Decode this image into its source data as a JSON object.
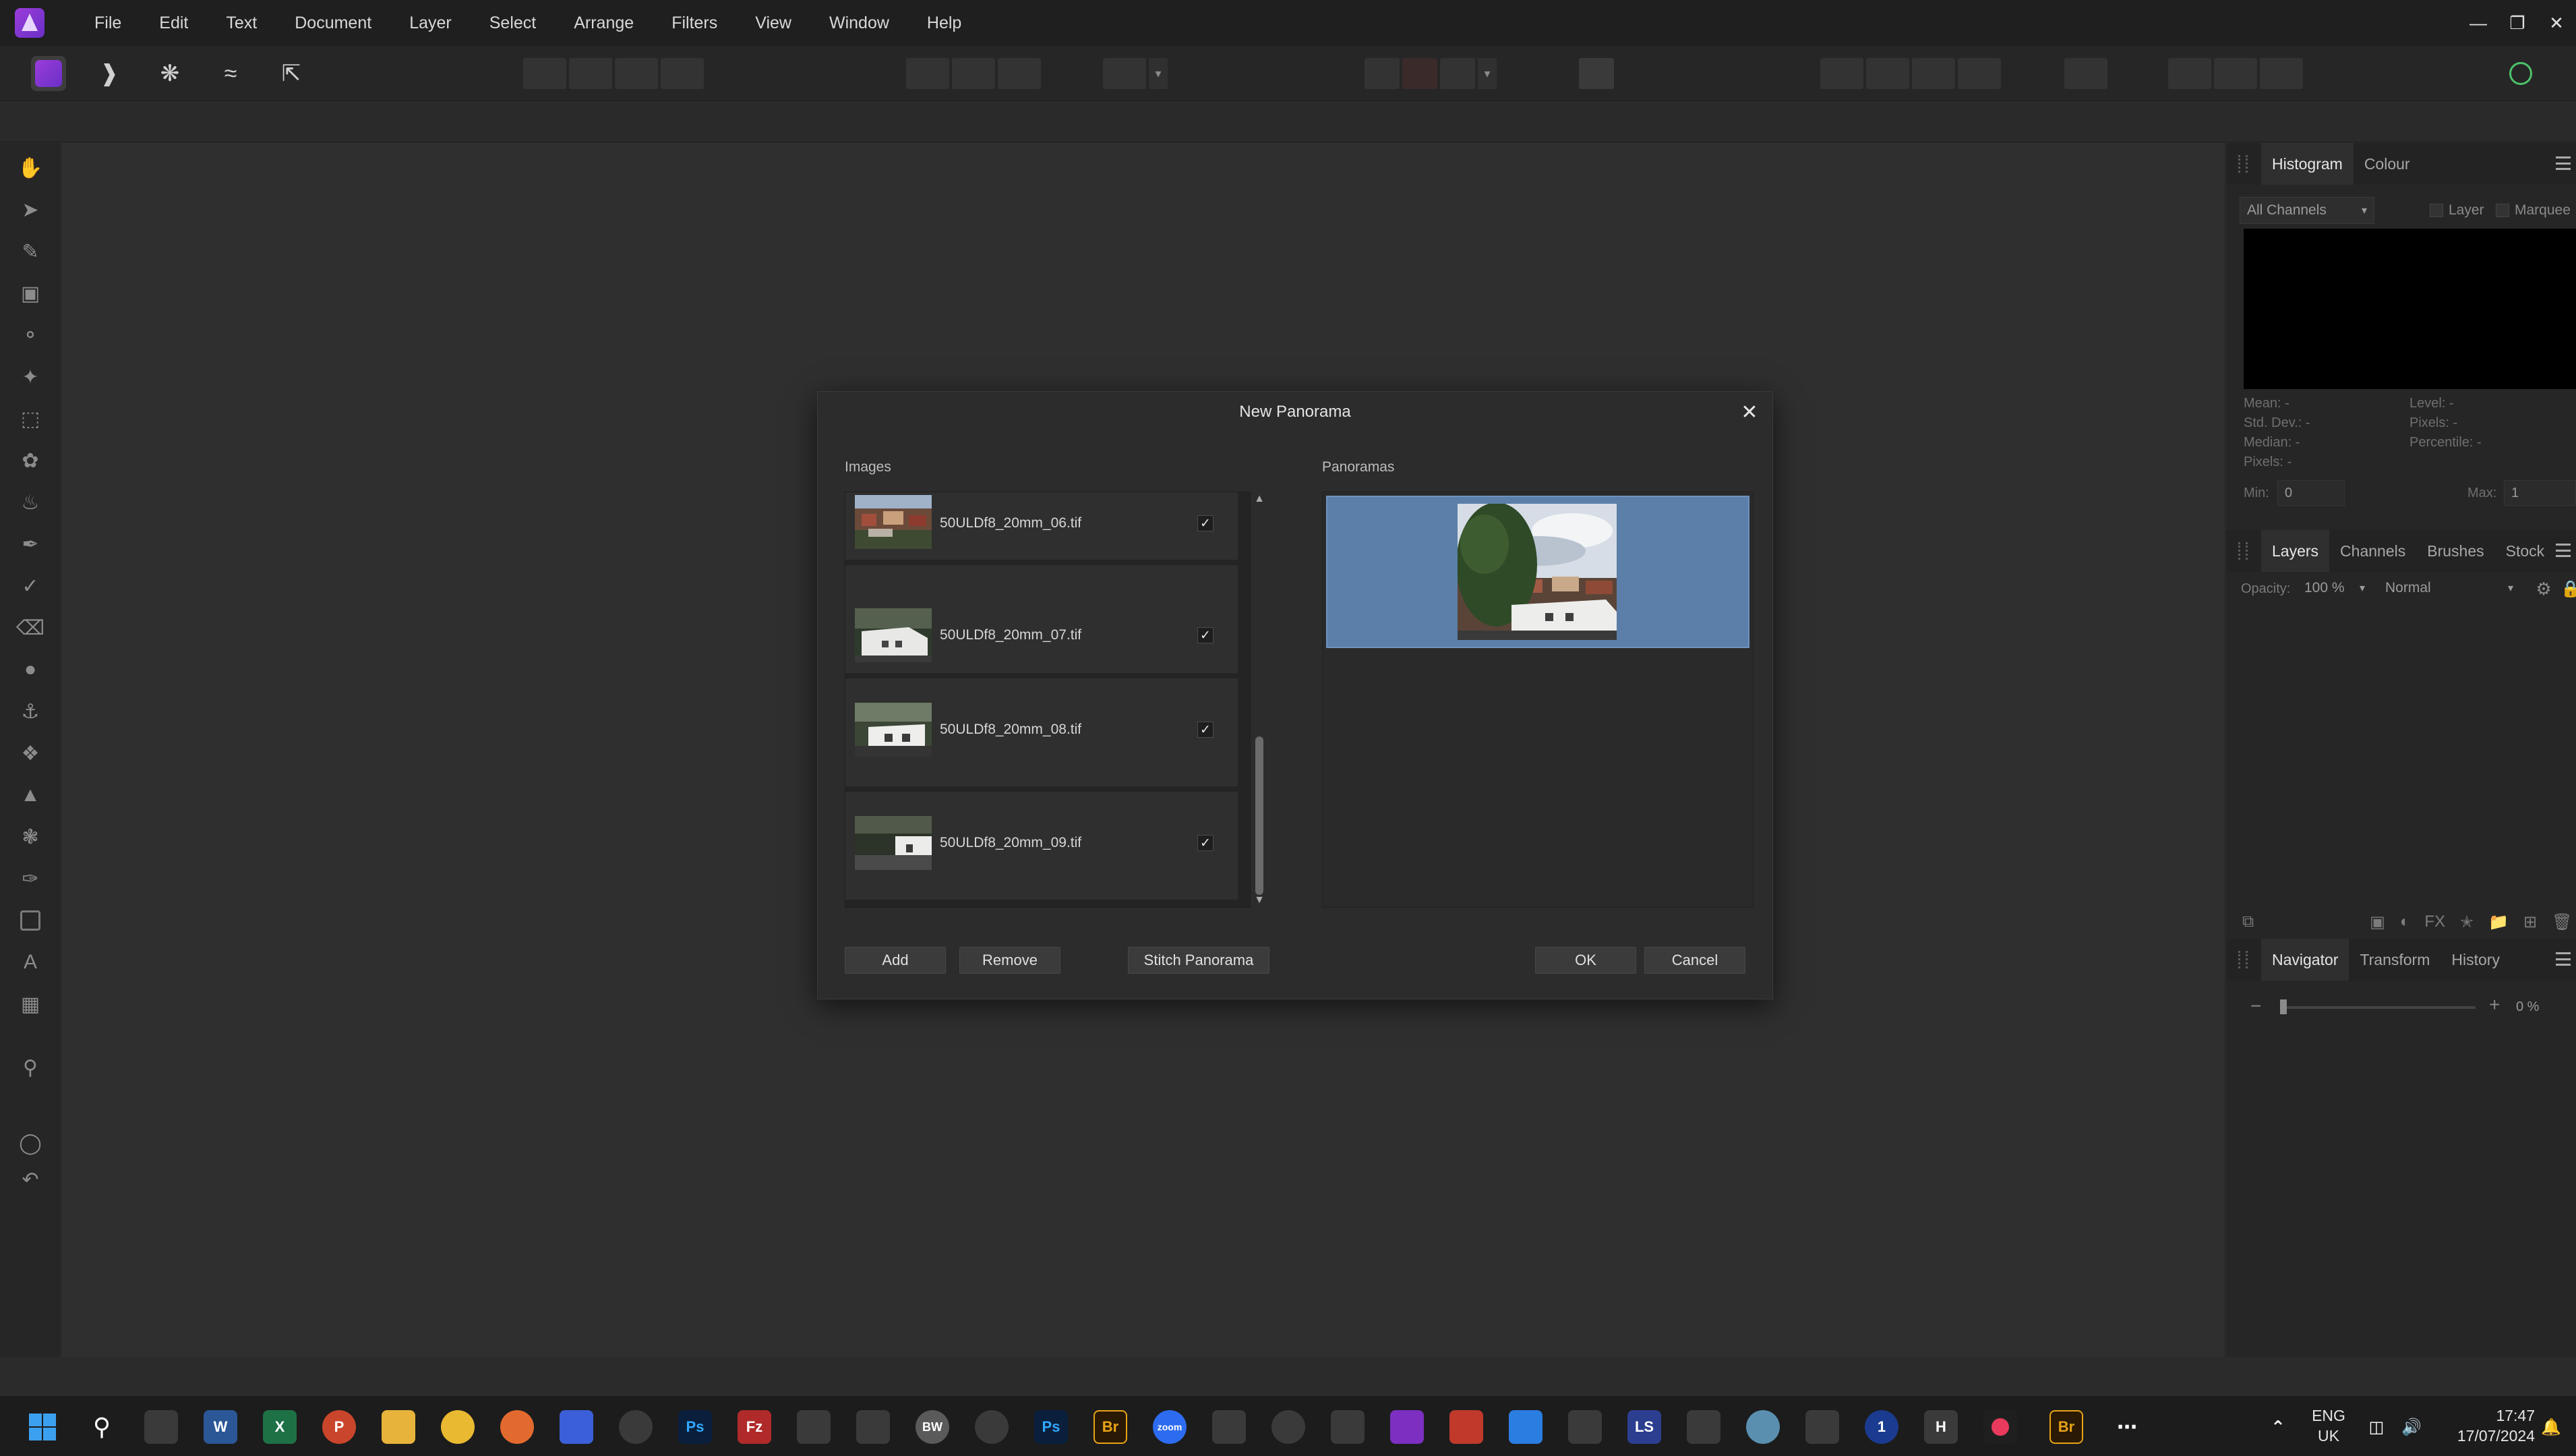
{
  "menu": [
    "File",
    "Edit",
    "Text",
    "Document",
    "Layer",
    "Select",
    "Arrange",
    "Filters",
    "View",
    "Window",
    "Help"
  ],
  "dialog": {
    "title": "New Panorama",
    "images_label": "Images",
    "panoramas_label": "Panoramas",
    "images": [
      {
        "name": "50ULDf8_20mm_06.tif",
        "checked": true
      },
      {
        "name": "50ULDf8_20mm_07.tif",
        "checked": true
      },
      {
        "name": "50ULDf8_20mm_08.tif",
        "checked": true
      },
      {
        "name": "50ULDf8_20mm_09.tif",
        "checked": true
      }
    ],
    "buttons": {
      "add": "Add",
      "remove": "Remove",
      "stitch": "Stitch Panorama",
      "ok": "OK",
      "cancel": "Cancel"
    },
    "selection_color": "#5b7fa8"
  },
  "histogram_panel": {
    "tabs": [
      "Histogram",
      "Colour"
    ],
    "channel": "All Channels",
    "layer_label": "Layer",
    "marquee_label": "Marquee",
    "stats_left": [
      "Mean: -",
      "Std. Dev.: -",
      "Median: -",
      "Pixels: -"
    ],
    "stats_right": [
      "Level: -",
      "Pixels: -",
      "Percentile: -"
    ],
    "min_label": "Min:",
    "min_value": "0",
    "max_label": "Max:",
    "max_value": "1"
  },
  "layers_panel": {
    "tabs": [
      "Layers",
      "Channels",
      "Brushes",
      "Stock"
    ],
    "opacity_label": "Opacity:",
    "opacity_value": "100 %",
    "blend_mode": "Normal"
  },
  "navigator_panel": {
    "tabs": [
      "Navigator",
      "Transform",
      "History"
    ],
    "zoom_value": "0 %"
  },
  "taskbar": {
    "language": "ENG",
    "region": "UK",
    "time": "17:47",
    "date": "17/07/2024"
  },
  "colors": {
    "accent": "#8e3fd8",
    "user_status": "#4cc26a"
  }
}
